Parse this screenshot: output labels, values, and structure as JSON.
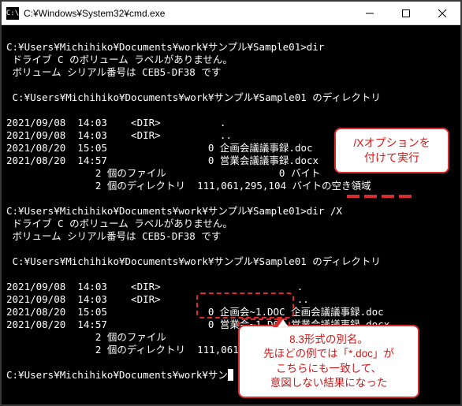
{
  "titlebar": {
    "icon_label": "C:\\",
    "title": "C:¥Windows¥System32¥cmd.exe"
  },
  "term": {
    "prompt1": "C:¥Users¥Michihiko¥Documents¥work¥サンプル¥Sample01>dir",
    "vol1": " ドライブ C のボリューム ラベルがありません。",
    "vol2": " ボリューム シリアル番号は CEB5-DF38 です",
    "blank": "",
    "dirof": " C:¥Users¥Michihiko¥Documents¥work¥サンプル¥Sample01 のディレクトリ",
    "r1": "2021/09/08  14:03    <DIR>          .",
    "r2": "2021/09/08  14:03    <DIR>          ..",
    "r3": "2021/08/20  15:05                 0 企画会議議事録.doc",
    "r4": "2021/08/20  14:57                 0 営業会議議事録.docx",
    "sum1": "               2 個のファイル                   0 バイト",
    "sum2": "               2 個のディレクトリ  111,061,295,104 バイトの空き領域",
    "prompt2": "C:¥Users¥Michihiko¥Documents¥work¥サンプル¥Sample01>dir /X",
    "xr1": "2021/09/08  14:03    <DIR>                       .",
    "xr2": "2021/09/08  14:03    <DIR>                       ..",
    "xr3": "2021/08/20  15:05                 0 企画会~1.DOC 企画会議議事録.doc",
    "xr4": "2021/08/20  14:57                 0 営業会~1.DOC 営業会議議事録.docx",
    "prompt3": "C:¥Users¥Michihiko¥Documents¥work¥サン"
  },
  "callouts": {
    "top_l1": "/Xオプションを",
    "top_l2": "付けて実行",
    "bottom_l1": "8.3形式の別名。",
    "bottom_l2": "先ほどの例では「*.doc」が",
    "bottom_l3": "こちらにも一致して、",
    "bottom_l4": "意図しない結果になった"
  }
}
